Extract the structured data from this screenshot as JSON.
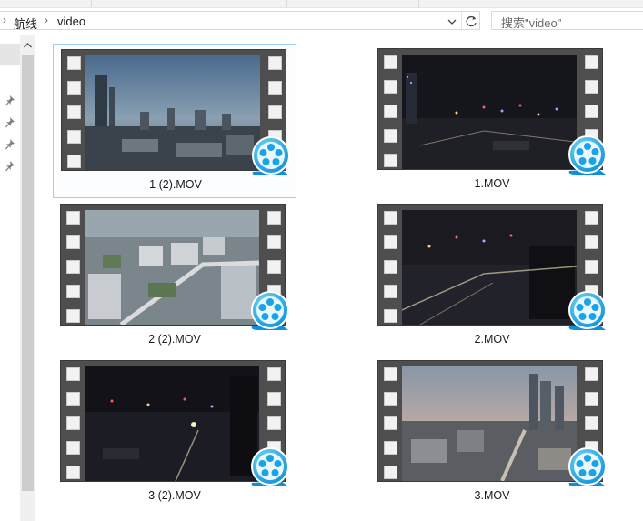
{
  "address": {
    "breadcrumbs": [
      "航线",
      "video"
    ]
  },
  "search": {
    "placeholder": "搜索\"video\""
  },
  "files": [
    {
      "name": "1 (2).MOV",
      "selected": true,
      "scene": "dusk"
    },
    {
      "name": "1.MOV",
      "selected": false,
      "scene": "night"
    },
    {
      "name": "2 (2).MOV",
      "selected": false,
      "scene": "day"
    },
    {
      "name": "2.MOV",
      "selected": false,
      "scene": "night-road"
    },
    {
      "name": "3 (2).MOV",
      "selected": false,
      "scene": "night-city"
    },
    {
      "name": "3.MOV",
      "selected": false,
      "scene": "dusk-towers"
    }
  ],
  "icons": {
    "file_badge": "media-player-icon",
    "pin": "pin-icon",
    "dropdown": "chevron-down-icon",
    "refresh": "refresh-icon"
  },
  "colors": {
    "selection_border": "#99d1ff",
    "badge_blue": "#19a9e8"
  }
}
